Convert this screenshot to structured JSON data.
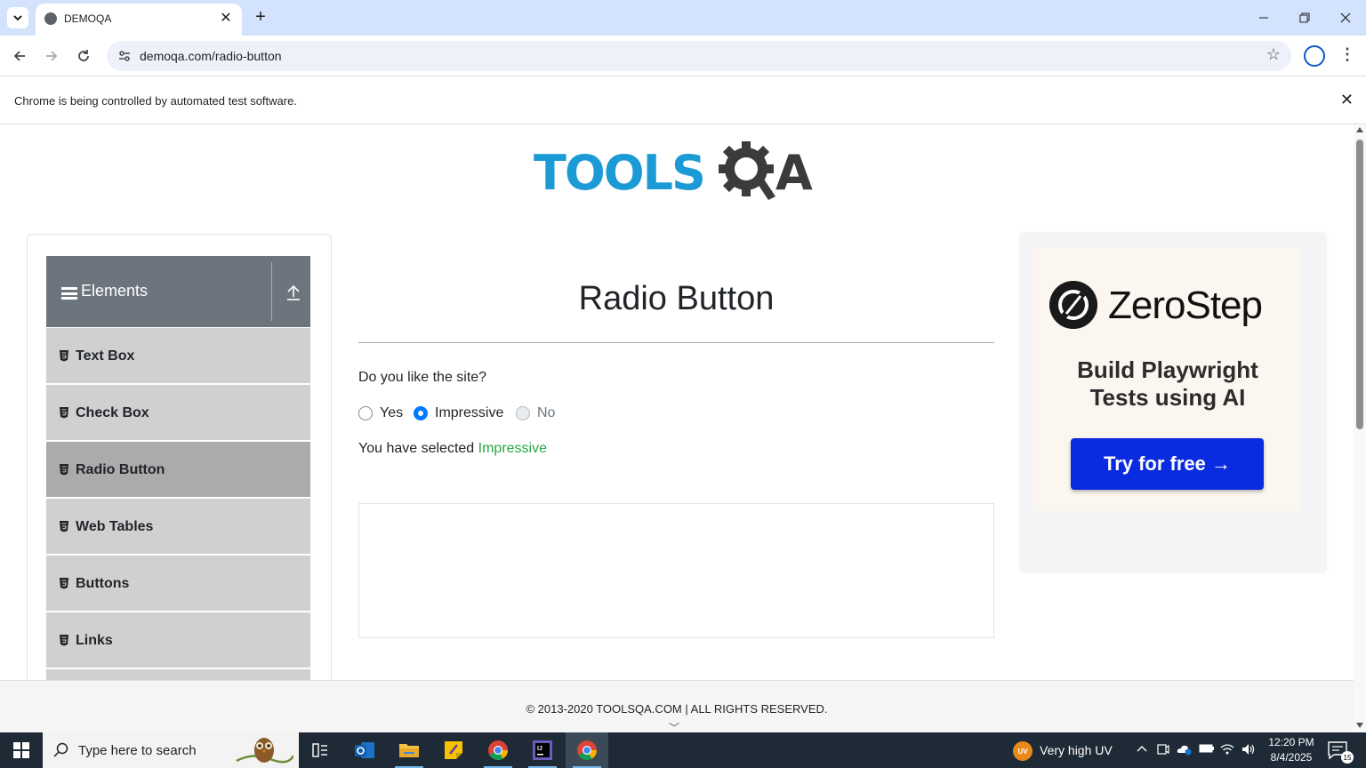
{
  "browser": {
    "tab_title": "DEMOQA",
    "url": "demoqa.com/radio-button",
    "infobar_text": "Chrome is being controlled by automated test software."
  },
  "site": {
    "logo_tools": "TOOLS",
    "logo_a": "A",
    "logo_colors": {
      "tools": "#1b9ad6",
      "qa": "#3b3b3b"
    }
  },
  "sidebar": {
    "group_title": "Elements",
    "items": [
      {
        "label": "Text Box",
        "active": false
      },
      {
        "label": "Check Box",
        "active": false
      },
      {
        "label": "Radio Button",
        "active": true
      },
      {
        "label": "Web Tables",
        "active": false
      },
      {
        "label": "Buttons",
        "active": false
      },
      {
        "label": "Links",
        "active": false
      }
    ]
  },
  "main": {
    "title": "Radio Button",
    "question": "Do you like the site?",
    "options": [
      {
        "label": "Yes",
        "checked": false,
        "disabled": false
      },
      {
        "label": "Impressive",
        "checked": true,
        "disabled": false
      },
      {
        "label": "No",
        "checked": false,
        "disabled": true
      }
    ],
    "result_prefix": "You have selected",
    "result_value": "Impressive",
    "accent_color": "#007bff",
    "success_color": "#28a745"
  },
  "ad": {
    "brand": "ZeroStep",
    "headline_line1": "Build Playwright",
    "headline_line2": "Tests using AI",
    "cta": "Try for free →",
    "cta_color": "#0b2be0"
  },
  "footer": {
    "text": "© 2013-2020 TOOLSQA.COM | ALL RIGHTS RESERVED."
  },
  "taskbar": {
    "search_placeholder": "Type here to search",
    "weather_badge": "UV",
    "weather_text": "Very high UV",
    "time": "12:20 PM",
    "date": "8/4/2025",
    "notification_count": "15",
    "apps": [
      "task-view",
      "outlook",
      "file-explorer",
      "sticky-notes",
      "chrome",
      "intellij",
      "chrome-active"
    ]
  }
}
